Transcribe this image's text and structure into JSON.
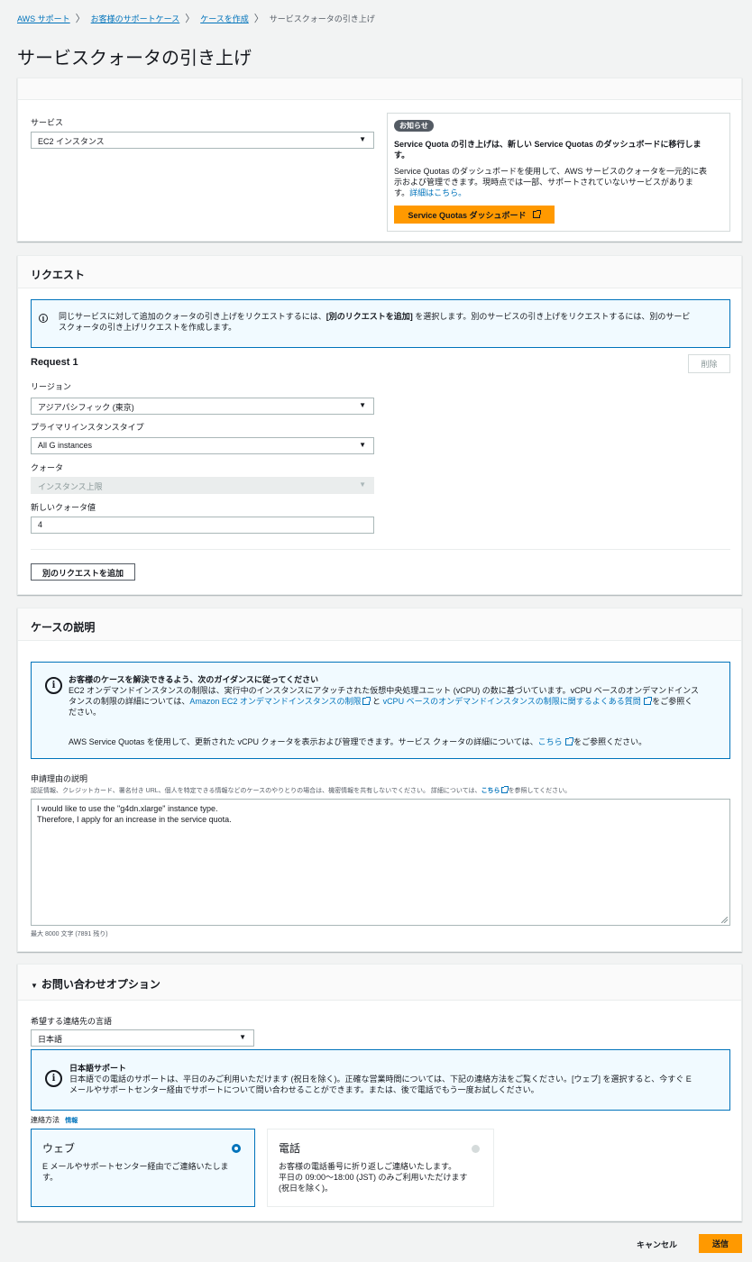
{
  "breadcrumb": {
    "items": [
      "AWS サポート",
      "お客様のサポートケース",
      "ケースを作成"
    ],
    "current": "サービスクォータの引き上げ",
    "separator": "〉"
  },
  "page_title": "サービスクォータの引き上げ",
  "service_panel": {
    "service_label": "サービス",
    "service_value": "EC2 インスタンス",
    "notice": {
      "badge": "お知らせ",
      "title_line1": "Service Quota の引き上げは、新しい Service Quotas のダッシュボードに移行しま",
      "title_line2": "す。",
      "body_line1": "Service Quotas のダッシュボードを使用して、AWS サービスのクォータを一元的に表",
      "body_line2": "示および管理できます。現時点では一部、サポートされていないサービスがありま",
      "body_line3_prefix": "す。",
      "link": "詳細はこちら。",
      "button": "Service Quotas ダッシュボード"
    }
  },
  "request_panel": {
    "header": "リクエスト",
    "info_line1_a": "同じサービスに対して追加のクォータの引き上げをリクエストするには、",
    "info_line1_b": "[別のリクエストを追加]",
    "info_line1_c": " を選択します。別のサービスの引き上げをリクエストするには、別のサービ",
    "info_line2": "スクォータの引き上げリクエストを作成します。",
    "request_title": "Request 1",
    "delete_button": "削除",
    "region_label": "リージョン",
    "region_value": "アジアパシフィック (東京)",
    "instance_type_label": "プライマリインスタンスタイプ",
    "instance_type_value": "All G instances",
    "quota_label": "クォータ",
    "quota_value": "インスタンス上限",
    "new_value_label": "新しいクォータ値",
    "new_value": "4",
    "add_request_button": "別のリクエストを追加"
  },
  "case_panel": {
    "header": "ケースの説明",
    "guidance_title": "お客様のケースを解決できるよう、次のガイダンスに従ってください",
    "guidance_line1": "EC2 オンデマンドインスタンスの制限は、実行中のインスタンスにアタッチされた仮想中央処理ユニット (vCPU) の数に基づいています。vCPU ベースのオンデマンドインス",
    "guidance_line2_a": "タンスの制限の詳細については、",
    "guidance_link1": "Amazon EC2 オンデマンドインスタンスの制限",
    "guidance_line2_b": " と ",
    "guidance_link2": "vCPU ベースのオンデマンドインスタンスの制限に関するよくある質問",
    "guidance_line2_c": "をご参照く",
    "guidance_line3": "ださい。",
    "sq_line_a": "AWS Service Quotas を使用して、更新された vCPU クォータを表示および管理できます。サービス クォータの詳細については、",
    "sq_link": "こちら",
    "sq_line_b": "をご参照ください。",
    "desc_label": "申請理由の説明",
    "desc_hint_a": "認証情報、クレジットカード、署名付き URL、個人を特定できる情報などのケースのやりとりの場合は、機密情報を共有しないでください。 詳細については、",
    "desc_hint_link": "こちら",
    "desc_hint_b": "を参照してください。",
    "desc_line1": "I would like to use the \"g4dn.xlarge\" instance type.",
    "desc_line2": "Therefore, I apply for an increase in the service quota.",
    "char_count": "最大 8000 文字 (7891 残り)"
  },
  "contact_panel": {
    "header": "お問い合わせオプション",
    "header_caret": "▼",
    "lang_label": "希望する連絡先の言語",
    "lang_value": "日本語",
    "jp_title": "日本語サポート",
    "jp_line1": "日本語での電話のサポートは、平日のみご利用いただけます (祝日を除く)。正確な営業時間については、下記の連絡方法をご覧ください。[ウェブ] を選択すると、今すぐ E",
    "jp_line2": "メールやサポートセンター経由でサポートについて問い合わせることができます。または、後で電話でもう一度お試しください。",
    "method_label": "連絡方法",
    "method_info": "情報",
    "web_title": "ウェブ",
    "web_line1": "E メールやサポートセンター経由でご連絡いたしま",
    "web_line2": "す。",
    "phone_title": "電話",
    "phone_line1": "お客様の電話番号に折り返しご連絡いたします。",
    "phone_line2": "平日の 09:00〜18:00 (JST) のみご利用いただけます",
    "phone_line3": "(祝日を除く)。"
  },
  "footer": {
    "cancel": "キャンセル",
    "submit": "送信"
  },
  "colors": {
    "accent_orange": "#ff9900",
    "link_blue": "#0073bb",
    "info_bg": "#f1faff",
    "badge_dark": "#545b64"
  }
}
